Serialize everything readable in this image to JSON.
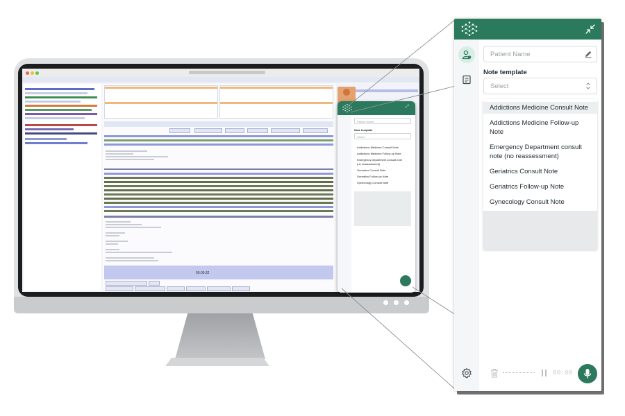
{
  "panel": {
    "patient_name_placeholder": "Patient Name",
    "note_template_label": "Note template",
    "select_placeholder": "Select",
    "templates": [
      "Addictions Medicine Consult Note",
      "Addictions Medicine Follow-up Note",
      "Emergency Department consult note (no reassessment)",
      "Geriatrics Consult Note",
      "Geriatrics Follow-up Note",
      "Gynecology Consult Note"
    ],
    "timer": "00:00",
    "icons": {
      "logo": "brand-logo-icon",
      "collapse": "collapse-arrows-icon",
      "patient_tab": "patient-icon",
      "notes_tab": "note-document-icon",
      "edit": "pencil-icon",
      "select_arrows": "chevron-up-down-icon",
      "settings": "gear-icon",
      "delete": "trash-icon",
      "pause": "pause-icon",
      "record": "microphone-icon"
    }
  },
  "mini_panel": {
    "patient_name_placeholder": "Patient Name",
    "note_template_label": "Note template",
    "select_placeholder": "Select",
    "templates": [
      "Addictions Medicine Consult Note",
      "Addictions Medicine Follow-up Note",
      "Emergency Department consult note",
      "(no reassessment)",
      "Geriatrics Consult Note",
      "Geriatrics Follow-up Note",
      "Gynecology Consult Note"
    ]
  },
  "emr": {
    "session_timer": "00:09:32"
  },
  "colors": {
    "brand_green": "#2c7a5e",
    "active_tab_bg": "#d8ede5",
    "dropdown_hover": "#eceff0"
  }
}
